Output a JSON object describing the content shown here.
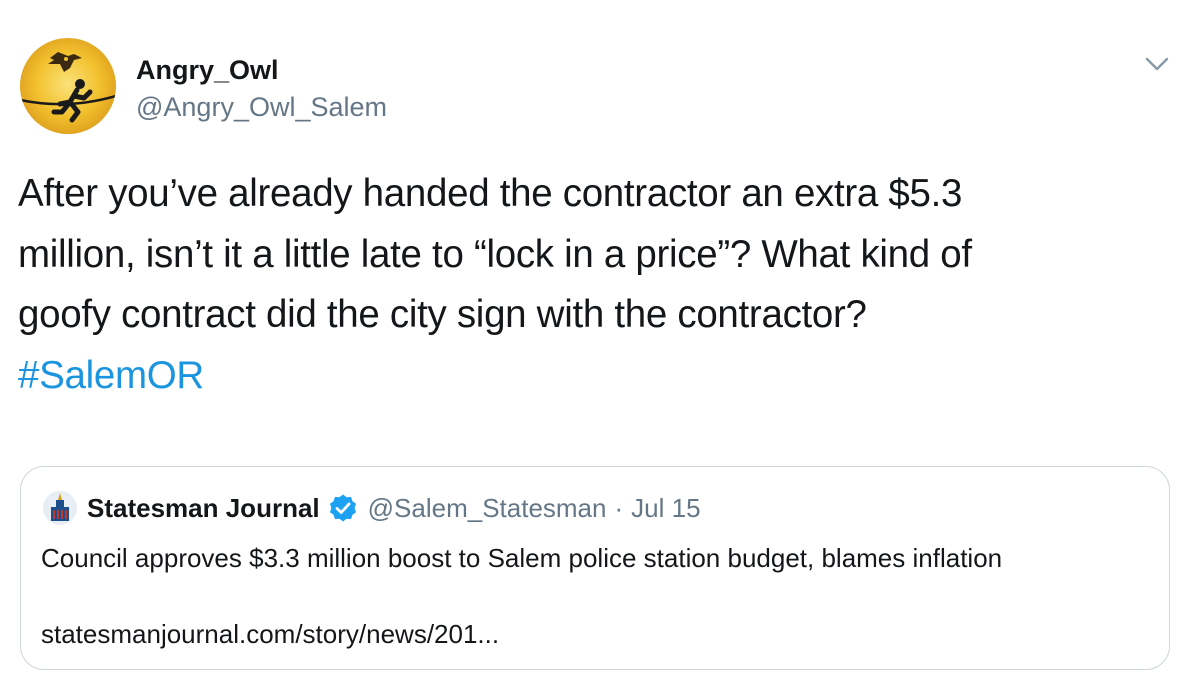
{
  "tweet": {
    "author": {
      "display_name": "Angry_Owl",
      "handle": "@Angry_Owl_Salem",
      "avatar_icon": "owl-runner-avatar"
    },
    "menu_icon": "chevron-down-icon",
    "text_lines": [
      "After you’ve already handed the contractor an extra $5.3",
      "million, isn’t it a little late to “lock in a price”? What kind of",
      "goofy contract did the city sign with the contractor?"
    ],
    "hashtag": "#SalemOR"
  },
  "quoted_tweet": {
    "display_name": "Statesman Journal",
    "verified": true,
    "handle": "@Salem_Statesman",
    "separator": "·",
    "date": "Jul 15",
    "text": "Council approves $3.3 million boost to Salem police station budget, blames inflation",
    "link": "statesmanjournal.com/story/news/201..."
  },
  "colors": {
    "link_blue": "#1b95e0",
    "secondary_text": "#657786",
    "border": "#ccd6dd",
    "avatar_yellow": "#f2c12e",
    "verified_blue": "#1da1f2"
  }
}
